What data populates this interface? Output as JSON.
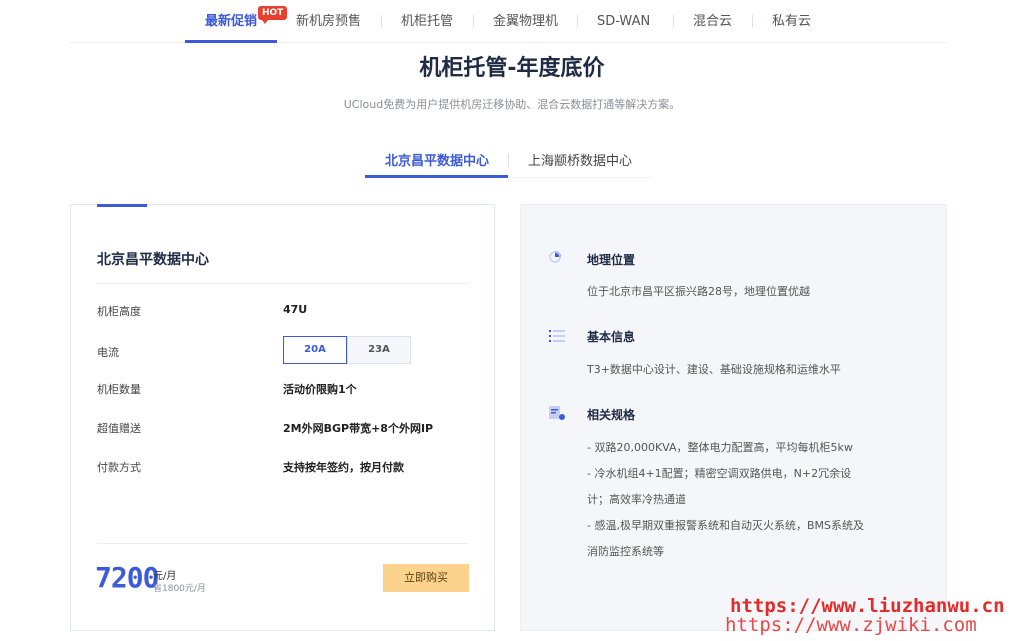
{
  "nav": {
    "items": [
      {
        "label": "最新促销",
        "active": true
      },
      {
        "label": "新机房预售"
      },
      {
        "label": "机柜托管"
      },
      {
        "label": "金翼物理机"
      },
      {
        "label": "SD-WAN"
      },
      {
        "label": "混合云"
      },
      {
        "label": "私有云"
      }
    ],
    "hot_badge": "HOT"
  },
  "page": {
    "title": "机柜托管-年度底价",
    "subtitle": "UCloud免费为用户提供机房迁移协助、混合云数据打通等解决方案。"
  },
  "dc_tabs": [
    {
      "label": "北京昌平数据中心",
      "active": true
    },
    {
      "label": "上海颛桥数据中心"
    }
  ],
  "card": {
    "title": "北京昌平数据中心",
    "rows": {
      "height": {
        "label": "机柜高度",
        "value": "47U"
      },
      "current": {
        "label": "电流",
        "options": [
          "20A",
          "23A"
        ],
        "selected": "20A"
      },
      "count": {
        "label": "机柜数量",
        "value": "活动价限购1个"
      },
      "gift": {
        "label": "超值赠送",
        "value": "2M外网BGP带宽+8个外网IP"
      },
      "payment": {
        "label": "付款方式",
        "value": "支持按年签约，按月付款"
      }
    },
    "price": "7200",
    "price_unit": "元/月",
    "price_save": "省1800元/月",
    "buy_label": "立即购买"
  },
  "info": {
    "location": {
      "title": "地理位置",
      "text": "位于北京市昌平区振兴路28号，地理位置优越",
      "icon": "location-icon"
    },
    "basic": {
      "title": "基本信息",
      "text": "T3+数据中心设计、建设、基础设施规格和运维水平",
      "icon": "list-icon"
    },
    "specs": {
      "title": "相关规格",
      "icon": "spec-icon",
      "lines": [
        "- 双路20,000KVA，整体电力配置高，平均每机柜5kw",
        "- 冷水机组4+1配置；精密空调双路供电，N+2冗余设",
        "计；高效率冷热通道",
        "- 感温,极早期双重报警系统和自动灭火系统，BMS系统及",
        "消防监控系统等"
      ]
    }
  },
  "watermarks": [
    "https://www.liuzhanwu.cn",
    "https://www.zjwiki.com"
  ],
  "colors": {
    "accent": "#3b5bdb",
    "buy": "#fbd38d",
    "hot": "#e8402c",
    "watermark": "#e52a2a"
  }
}
